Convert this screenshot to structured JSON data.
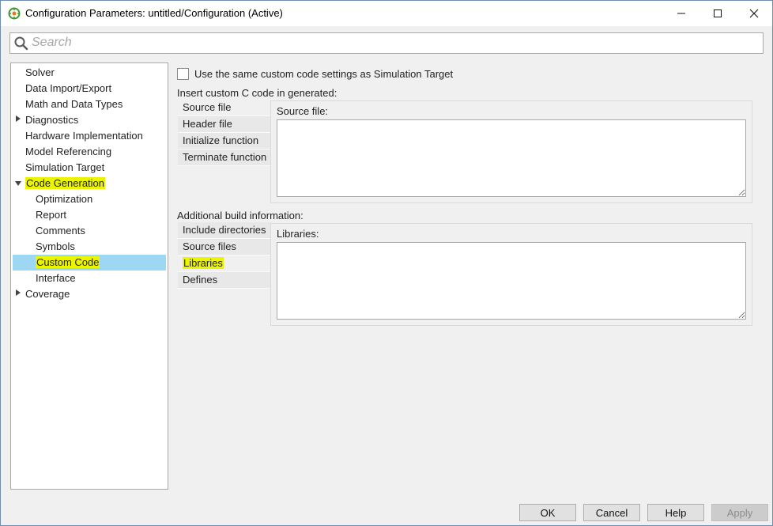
{
  "window": {
    "title": "Configuration Parameters: untitled/Configuration (Active)",
    "minimize_glyph": "—",
    "maximize_glyph": "☐",
    "close_glyph": "✕"
  },
  "search": {
    "placeholder": "Search",
    "value": ""
  },
  "tree": {
    "items": [
      {
        "label": "Solver",
        "level": 0,
        "expander": "none"
      },
      {
        "label": "Data Import/Export",
        "level": 0,
        "expander": "none"
      },
      {
        "label": "Math and Data Types",
        "level": 0,
        "expander": "none"
      },
      {
        "label": "Diagnostics",
        "level": 0,
        "expander": "collapsed"
      },
      {
        "label": "Hardware Implementation",
        "level": 0,
        "expander": "none"
      },
      {
        "label": "Model Referencing",
        "level": 0,
        "expander": "none"
      },
      {
        "label": "Simulation Target",
        "level": 0,
        "expander": "none"
      },
      {
        "label": "Code Generation",
        "level": 0,
        "expander": "expanded",
        "highlighted": true
      },
      {
        "label": "Optimization",
        "level": 1
      },
      {
        "label": "Report",
        "level": 1
      },
      {
        "label": "Comments",
        "level": 1
      },
      {
        "label": "Symbols",
        "level": 1
      },
      {
        "label": "Custom Code",
        "level": 1,
        "selected": true,
        "highlighted": true
      },
      {
        "label": "Interface",
        "level": 1
      },
      {
        "label": "Coverage",
        "level": 0,
        "expander": "collapsed"
      }
    ],
    "selection_color": "#9ed7f4",
    "highlight_color": "#ecf500"
  },
  "main": {
    "same_settings_label": "Use the same custom code settings as Simulation Target",
    "same_settings_checked": false,
    "insert_section": {
      "label": "Insert custom C code in generated:",
      "tabs": [
        "Source file",
        "Header file",
        "Initialize function",
        "Terminate function"
      ],
      "active_tab": "Source file",
      "panel_label": "Source file:",
      "value": ""
    },
    "build_section": {
      "label": "Additional build information:",
      "tabs": [
        "Include directories",
        "Source files",
        "Libraries",
        "Defines"
      ],
      "active_tab": "Libraries",
      "panel_label": "Libraries:",
      "value": ""
    }
  },
  "buttons": {
    "ok": "OK",
    "cancel": "Cancel",
    "help": "Help",
    "apply": "Apply"
  }
}
